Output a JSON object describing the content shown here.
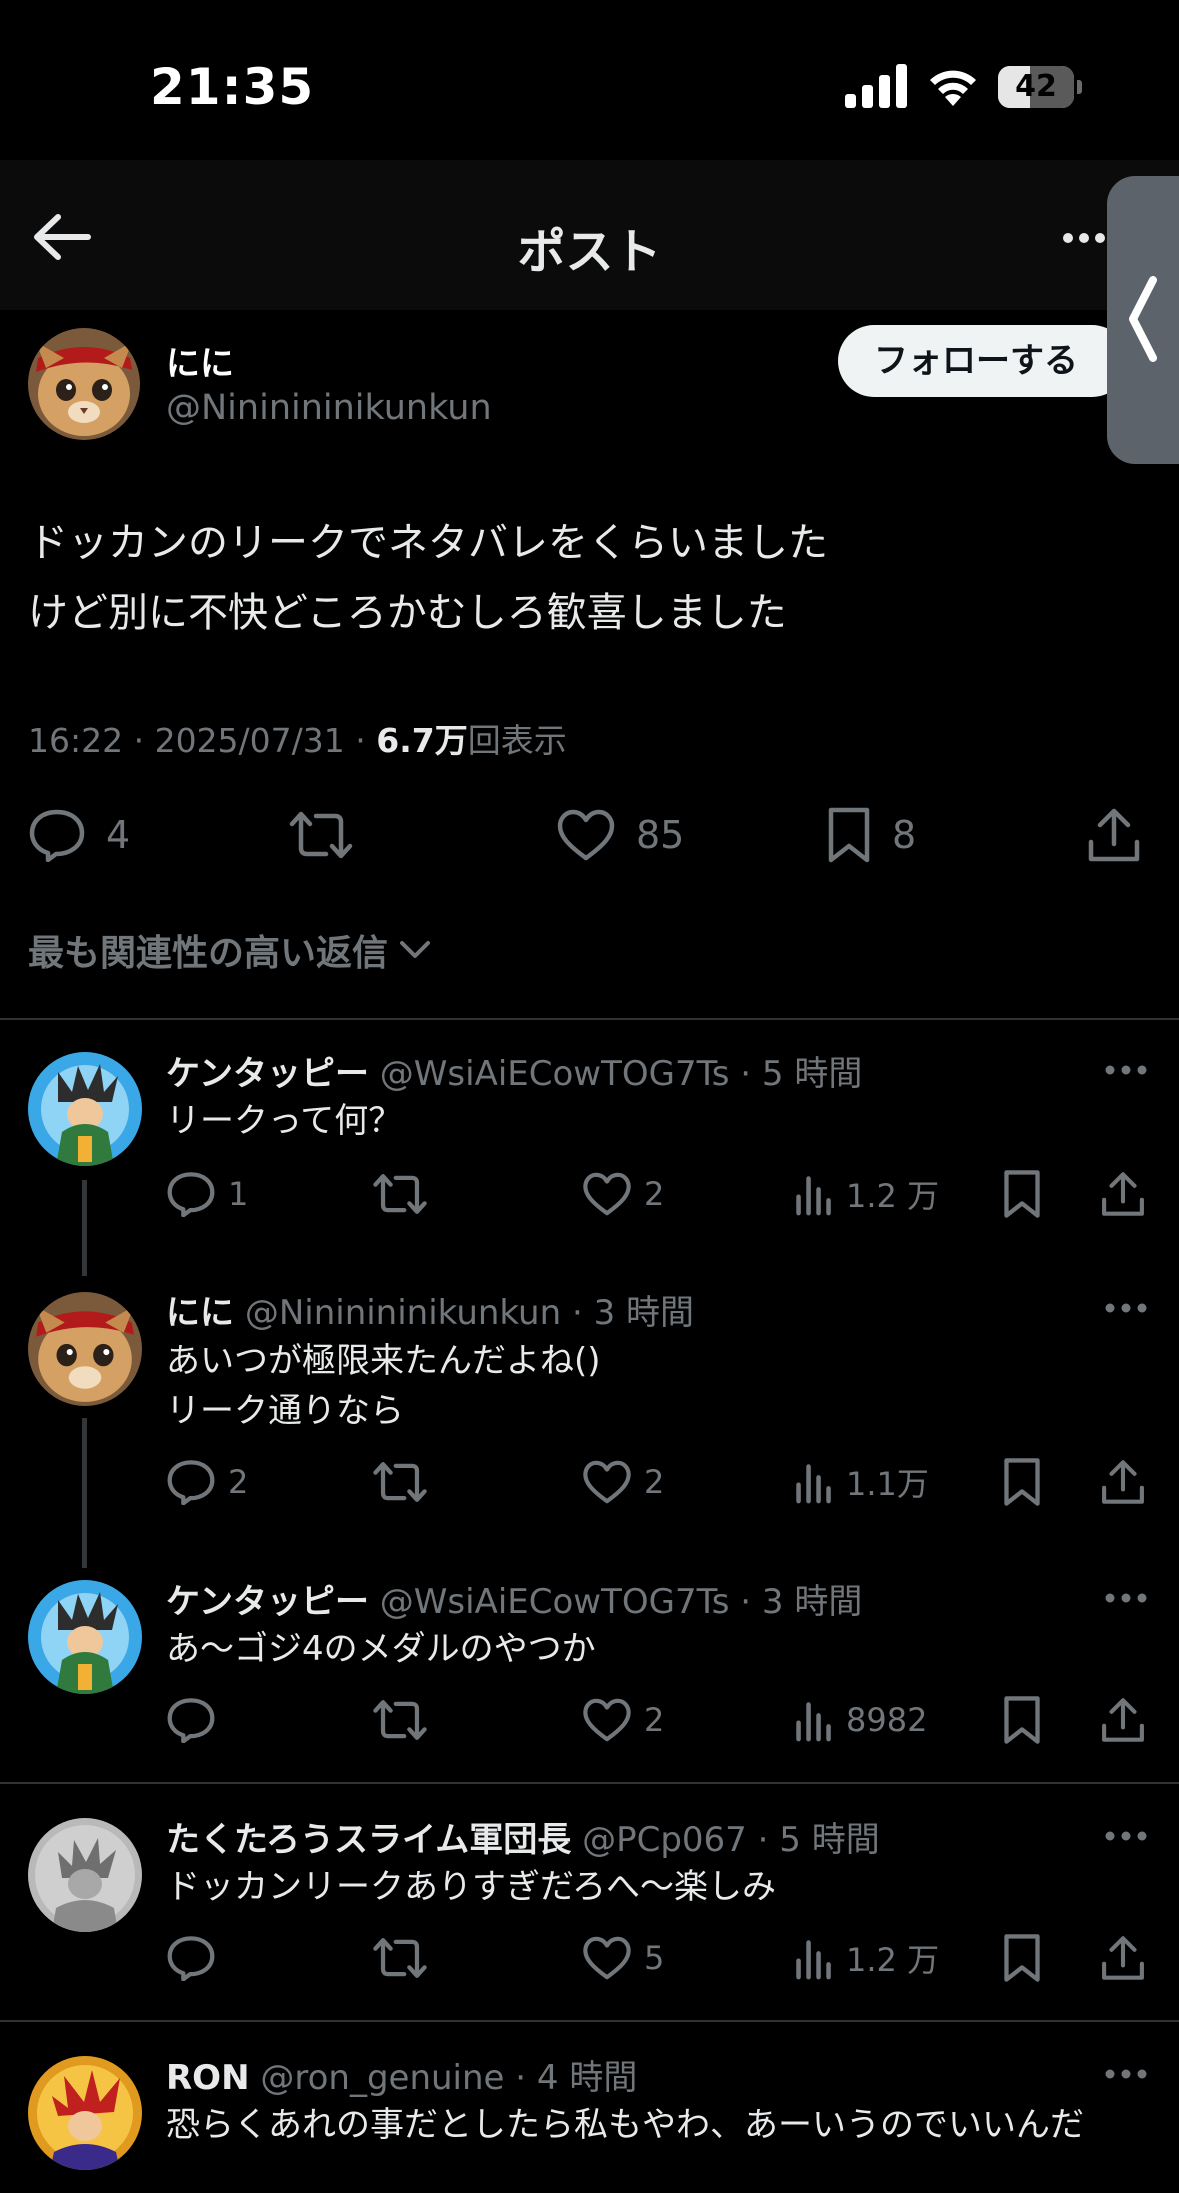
{
  "status_bar": {
    "time": "21:35",
    "battery": "42",
    "battery_level": 0.42,
    "icons": [
      "cellular-signal-icon",
      "wifi-icon",
      "battery-icon"
    ]
  },
  "header": {
    "title": "ポスト",
    "back_icon": "arrow-left-icon",
    "more_icon": "more-horizontal-icon"
  },
  "side_tab": {
    "icon": "chevron-left-icon"
  },
  "post": {
    "display_name": "にに",
    "handle": "@Nininininikunkun",
    "follow_label": "フォローする",
    "text_lines": [
      "ドッカンのリークでネタバレをくらいました",
      "けど別に不快どころかむしろ歓喜しました"
    ],
    "timestamp": "16:22 · 2025/07/31 · ",
    "views": "6.7万",
    "views_suffix": "回表示",
    "actions": {
      "replies": "4",
      "retweets": "",
      "likes": "85",
      "bookmarks": "8"
    }
  },
  "sort_label": "最も関連性の高い返信",
  "replies": [
    {
      "name": "ケンタッピー",
      "handle": "@WsiAiECowTOG7Ts",
      "time": " · 5 時間",
      "text": [
        "リークって何？"
      ],
      "replies": "1",
      "likes": "2",
      "views": "1.2 万"
    },
    {
      "name": "にに",
      "handle": "@Nininininikunkun",
      "time": " · 3 時間",
      "text": [
        "あいつが極限来たんだよね()",
        "リーク通りなら"
      ],
      "replies": "2",
      "likes": "2",
      "views": "1.1万"
    },
    {
      "name": "ケンタッピー",
      "handle": "@WsiAiECowTOG7Ts",
      "time": " · 3 時間",
      "text": [
        "あ〜ゴジ4のメダルのやつか"
      ],
      "replies": "",
      "likes": "2",
      "views": "8982"
    },
    {
      "name": "たくたろうスライム軍団長",
      "handle": "@PCp067",
      "time": " · 5 時間",
      "text": [
        "ドッカンリークありすぎだろへ〜楽しみ"
      ],
      "replies": "",
      "likes": "5",
      "views": "1.2 万"
    },
    {
      "name": "RON",
      "handle": "@ron_genuine",
      "time": " · 4 時間",
      "text": [
        "恐らくあれの事だとしたら私もやわ、あーいうのでいいんだ"
      ],
      "replies": "",
      "likes": "",
      "views": ""
    }
  ]
}
